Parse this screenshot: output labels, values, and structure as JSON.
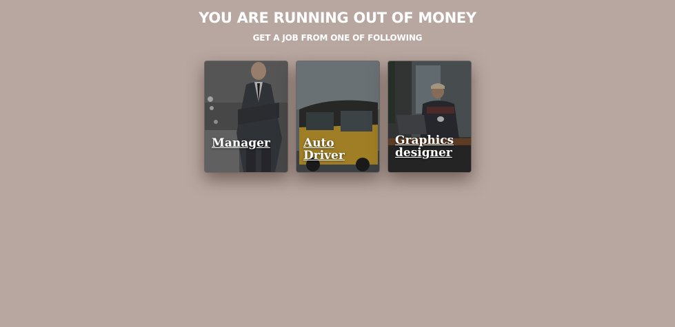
{
  "header": {
    "title": "YOU ARE RUNNING OUT OF MONEY",
    "subtitle": "GET A JOB FROM ONE OF FOLLOWING"
  },
  "jobs": [
    {
      "label": "Manager",
      "image": "businessman-photo"
    },
    {
      "label": "Auto Driver",
      "image": "auto-rickshaw-photo"
    },
    {
      "label": "Graphics designer",
      "image": "designer-at-laptop-photo"
    }
  ],
  "colors": {
    "background": "#b8a7a0",
    "text": "#ffffff"
  }
}
